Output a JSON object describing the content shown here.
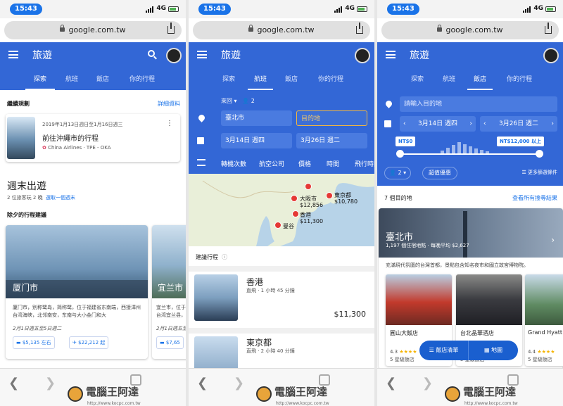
{
  "status": {
    "time": "15:43",
    "network": "4G"
  },
  "browser": {
    "url": "google.com.tw"
  },
  "app": {
    "title": "旅遊"
  },
  "tabs": [
    {
      "label": "探索"
    },
    {
      "label": "航班"
    },
    {
      "label": "飯店"
    },
    {
      "label": "你的行程"
    }
  ],
  "explore": {
    "continue_heading": "繼續規劃",
    "details_link": "詳細資料",
    "trip_date": "2019年1月13日週日至1月16日週三",
    "trip_title": "前往沖繩市的行程",
    "trip_airline": "China Airlines · TPE - OKA",
    "weekend_heading": "週末出遊",
    "weekend_sub": "2 位旅客玩 2 晚",
    "weekend_choose": "選取一個週末",
    "tonight_heading": "除夕的行程建議",
    "dest1": {
      "name": "厦门市",
      "desc": "厦门市，别称鹭岛，简称鹭，位于福建省东南端，西接漳州台湾海峡，北邻南安，东南与大小金门和大",
      "date": "2月1日週五至5日週二",
      "hotel_price": "$5,135 左右",
      "flight_price": "$22,212 起"
    },
    "dest2": {
      "name": "宜兰市",
      "desc": "宜兰市，位于台湾宜兰县，面积 46.6 公里",
      "date": "2月1日週五至5日",
      "hotel_price": "$7,65"
    }
  },
  "flights": {
    "trip_type": "來回",
    "passengers": "2",
    "origin": "臺北市",
    "destination_placeholder": "目的地",
    "depart": "3月14日 週四",
    "return": "3月26日 週二",
    "filters": [
      "轉機次數",
      "航空公司",
      "價格",
      "時間",
      "飛行時間"
    ],
    "map_labels": [
      {
        "city": "大阪市",
        "price": "$12,856"
      },
      {
        "city": "東京都",
        "price": "$10,780"
      },
      {
        "city": "香港",
        "price": "$11,300"
      },
      {
        "city": "曼谷",
        "price": ""
      }
    ],
    "suggest_heading": "建議行程",
    "results": [
      {
        "city": "香港",
        "meta": "直飛 · 1 小時 45 分鐘",
        "price": "$11,300"
      },
      {
        "city": "東京都",
        "meta": "直飛 · 2 小時 40 分鐘",
        "price": ""
      }
    ]
  },
  "hotels": {
    "dest_placeholder": "請輸入目的地",
    "checkin": "3月14日 週四",
    "checkout": "3月26日 週二",
    "price_min": "NT$0",
    "price_max": "NT$12,000 以上",
    "guests": "2",
    "deals": "超值優惠",
    "more_filters": "更多篩選條件",
    "count": "7 個目的地",
    "view_all": "查看所有搜尋結果",
    "city": "臺北市",
    "city_meta": "1,197 個住宿地點 · 每晚平均 $2,627",
    "city_desc": "充滿現代氛圍的台灣首都，景點包含知名夜市和國立故宮博物院。",
    "list": [
      {
        "name": "圓山大飯店",
        "rating": "4.3",
        "stars": "5 星級飯店"
      },
      {
        "name": "台北晶華酒店",
        "rating": "",
        "stars": "5 星級飯店"
      },
      {
        "name": "Grand Hyatt",
        "rating": "4.4",
        "stars": "5 星級飯店"
      }
    ],
    "list_button": "飯店清單",
    "map_button": "地圖"
  },
  "watermark": {
    "brand": "電腦王阿達",
    "site": "http://www.kocpc.com.tw"
  }
}
